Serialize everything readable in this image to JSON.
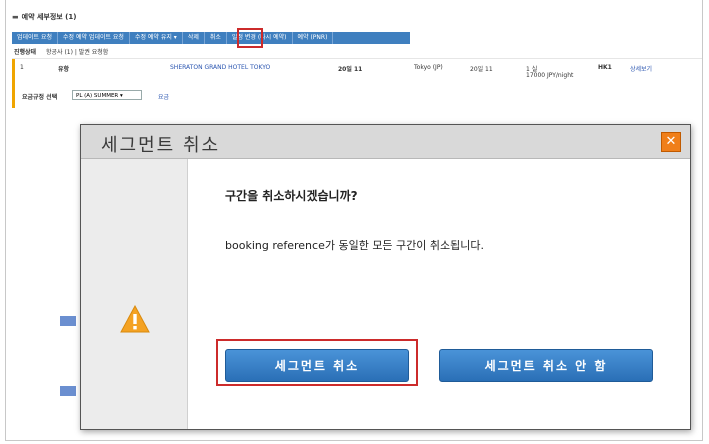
{
  "page": {
    "section_title": "예약 세부정보 (1)"
  },
  "toolbar": {
    "items": [
      "업데이트 요청",
      "수정 예약 업데이트 요청",
      "수정 예약 유지 ▾",
      "삭제",
      "취소",
      "일정 변경 (다시 예약)",
      "예약 (PNR)"
    ]
  },
  "booking": {
    "header_label": "진행상태",
    "header_value": "항공사 (1) | 발권 요청함",
    "row_num": "1",
    "status": "유항",
    "hotel": "SHERATON GRAND HOTEL TOKYO",
    "date": "20일 11",
    "city": "Tokyo (JP)",
    "date2": "20일 11",
    "rooms": "1 실",
    "rate_line": "17000 JPY/night",
    "code": "HK1",
    "more_link": "상세보기",
    "fare_label": "요금규정 선택",
    "fare_select": "PL (A) SUMMER ▾",
    "fare_link": "요금"
  },
  "dialog": {
    "title": "세그먼트 취소",
    "close_label": "✕",
    "question": "구간을 취소하시겠습니까?",
    "message": "booking reference가 동일한 모든 구간이 취소됩니다.",
    "confirm_button": "세그먼트 취소",
    "dismiss_button": "세그먼트 취소 안 함"
  }
}
